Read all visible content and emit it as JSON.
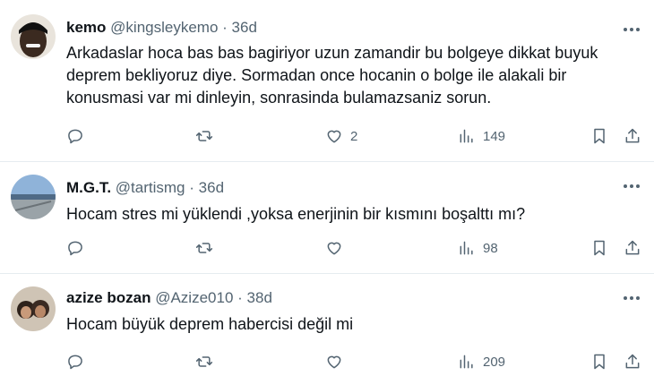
{
  "tweets": [
    {
      "name": "kemo",
      "handle": "@kingsleykemo",
      "sep": "·",
      "time": "36d",
      "text": "Arkadaslar hoca bas bas bagiriyor uzun zamandir bu bolgeye dikkat buyuk deprem bekliyoruz diye. Sormadan once hocanin o bolge ile alakali bir konusmasi var mi dinleyin, sonrasinda bulamazsaniz sorun.",
      "likes": "2",
      "views": "149"
    },
    {
      "name": "M.G.T.",
      "handle": "@tartismg",
      "sep": "·",
      "time": "36d",
      "text": "Hocam stres mi yüklendi ,yoksa enerjinin bir kısmını boşalttı mı?",
      "likes": "",
      "views": "98"
    },
    {
      "name": "azize bozan",
      "handle": "@Azize010",
      "sep": "·",
      "time": "38d",
      "text": "Hocam büyük deprem habercisi değil mi",
      "likes": "",
      "views": "209"
    }
  ],
  "colors": {
    "text": "#0f1419",
    "secondary": "#536471",
    "divider": "#e6ecf0"
  },
  "icons": [
    "reply-icon",
    "retweet-icon",
    "like-icon",
    "views-icon",
    "bookmark-icon",
    "share-icon",
    "more-icon"
  ]
}
